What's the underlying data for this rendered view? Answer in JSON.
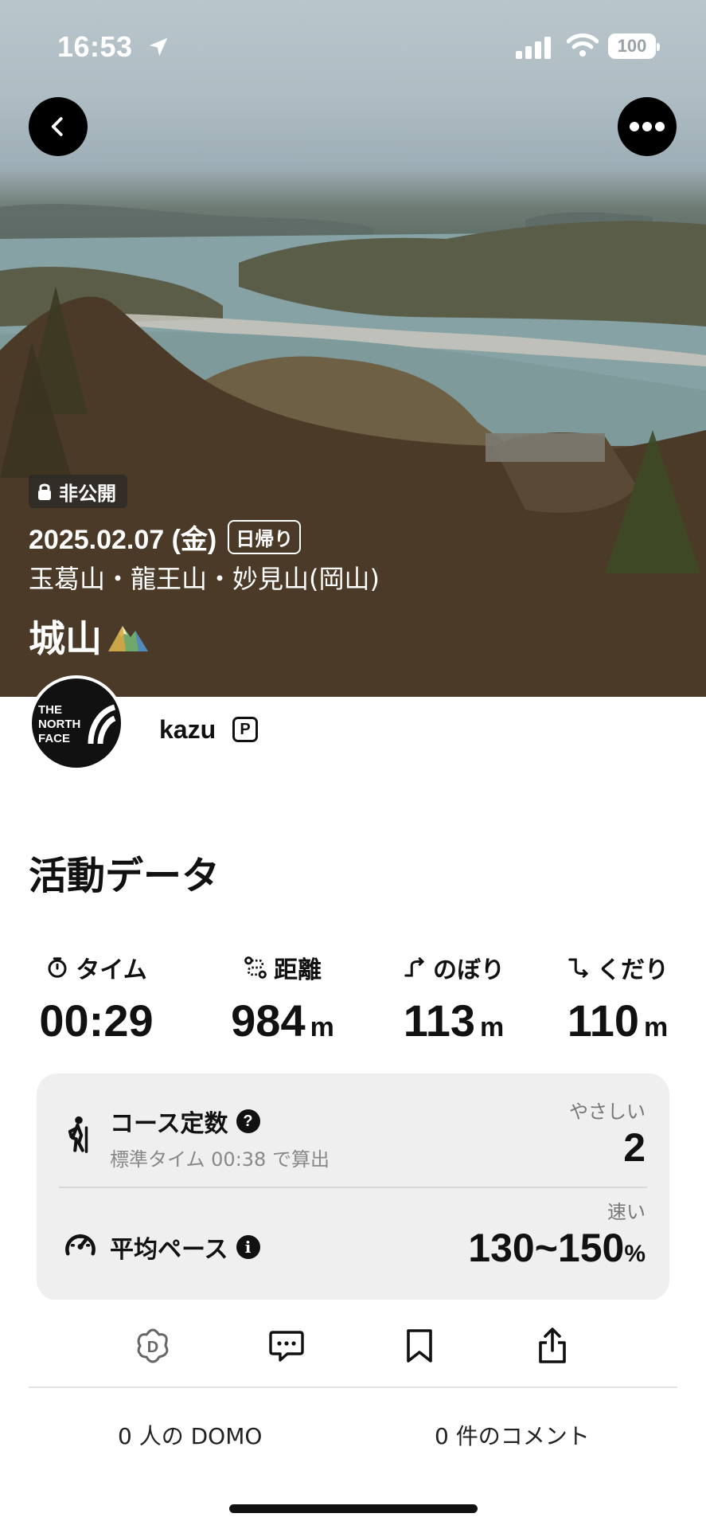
{
  "status_bar": {
    "time": "16:53",
    "battery": "100"
  },
  "hero": {
    "privacy_label": "非公開",
    "date": "2025.02.07 (金)",
    "trip_type": "日帰り",
    "area": "玉葛山・龍王山・妙見山(岡山)",
    "title": "城山"
  },
  "user": {
    "logo_text": "THE NORTH FACE",
    "name": "kazu",
    "badge": "P"
  },
  "activity": {
    "section_title": "活動データ",
    "stats": [
      {
        "label": "タイム",
        "value": "00:29",
        "unit": "",
        "icon": "timer-icon"
      },
      {
        "label": "距離",
        "value": "984",
        "unit": "m",
        "icon": "route-icon"
      },
      {
        "label": "のぼり",
        "value": "113",
        "unit": "m",
        "icon": "ascent-icon"
      },
      {
        "label": "くだり",
        "value": "110",
        "unit": "m",
        "icon": "descent-icon"
      }
    ]
  },
  "card": {
    "course": {
      "label": "コース定数",
      "sub": "標準タイム 00:38 で算出",
      "rating": "やさしい",
      "value": "2"
    },
    "pace": {
      "label": "平均ペース",
      "rating": "速い",
      "value": "130~150",
      "unit": "%"
    }
  },
  "actions": [
    "domo-icon",
    "comment-icon",
    "bookmark-icon",
    "share-icon"
  ],
  "footer": {
    "domo": "0 人の DOMO",
    "comments": "0 件のコメント"
  },
  "colors": {
    "text": "#111111",
    "card_bg": "#efefef",
    "muted": "#888888"
  }
}
